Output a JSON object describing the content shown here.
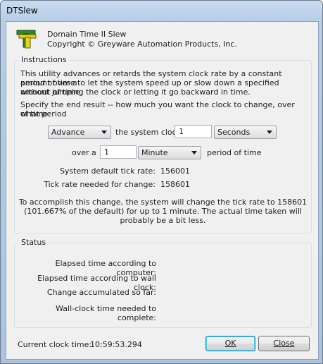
{
  "window": {
    "title": "DTSlew"
  },
  "header": {
    "app_name": "Domain Time II Slew",
    "copyright": "Copyright © Greyware Automation Products, Inc."
  },
  "instructions": {
    "group_label": "Instructions",
    "para1_line1": "This utility advances or retards the system clock rate by a constant amount over a",
    "para1_line2": "period of time to let the system speed up or slow down a specified amount of time",
    "para1_line3": "without jumping the clock or letting it go backward in time.",
    "para2_line1": "Specify the end result -- how much you want the clock to change, over what period",
    "para2_line2": "of time.",
    "direction_value": "Advance",
    "system_clock_label": "the system clock",
    "amount_value": "1",
    "amount_unit_value": "Seconds",
    "over_a_label": "over a",
    "period_value": "1",
    "period_unit_value": "Minute",
    "period_of_time_label": "period of time",
    "default_tick_label": "System default tick rate:",
    "default_tick_value": "156001",
    "needed_tick_label": "Tick rate needed for change:",
    "needed_tick_value": "158601",
    "summary_line1": "To accomplish this change, the system will change the tick rate to 158601",
    "summary_line2": "(101.667% of the default) for up to 1 minute. The actual time taken will",
    "summary_line3": "probably be a bit less."
  },
  "status": {
    "group_label": "Status",
    "elapsed_computer_label": "Elapsed time according to computer:",
    "elapsed_wall_label": "Elapsed time according to wall clock:",
    "change_accum_label": "Change accumulated so far:",
    "wall_needed_label": "Wall-clock time needed to complete:"
  },
  "footer": {
    "clock_label": "Current clock time:",
    "clock_value": "10:59:53.294",
    "ok_label": "OK",
    "close_label": "Close"
  }
}
